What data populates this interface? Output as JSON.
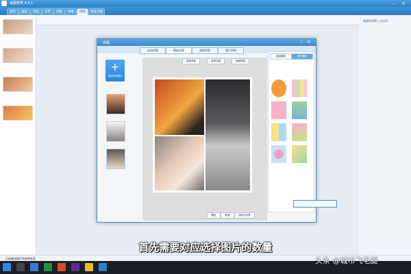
{
  "app": {
    "title": "美图秀秀 4.0.1",
    "tabs": [
      "首页",
      "美化",
      "饰品",
      "文字",
      "边框",
      "场景",
      "拼图",
      "更多功能"
    ],
    "active_tab_index": 6,
    "right_panel_text": "美图秀秀第三方应用"
  },
  "dialog": {
    "title": "拼图",
    "tabs": [
      "自由拼图",
      "模板拼图",
      "海报拼图",
      "图片拼接"
    ],
    "active_tab_index": 1,
    "add_button_caption": "添加多张图片",
    "toolbar_buttons": [
      "选择背景",
      "选择边框",
      "画板颜色"
    ],
    "panel_tabs": [
      "选择模板",
      "单张模板"
    ],
    "bottom_buttons": [
      "确定",
      "取消",
      "保存与分享"
    ]
  },
  "status_text": "已经美化图片的各种标签",
  "subtitle": "首先需要对应选择图片的数量",
  "watermark": "头条 @城市飞毛腿",
  "colors": {
    "accent": "#2f82c6",
    "taskbar": "#1b1e26",
    "orange": "#f39a3a"
  }
}
